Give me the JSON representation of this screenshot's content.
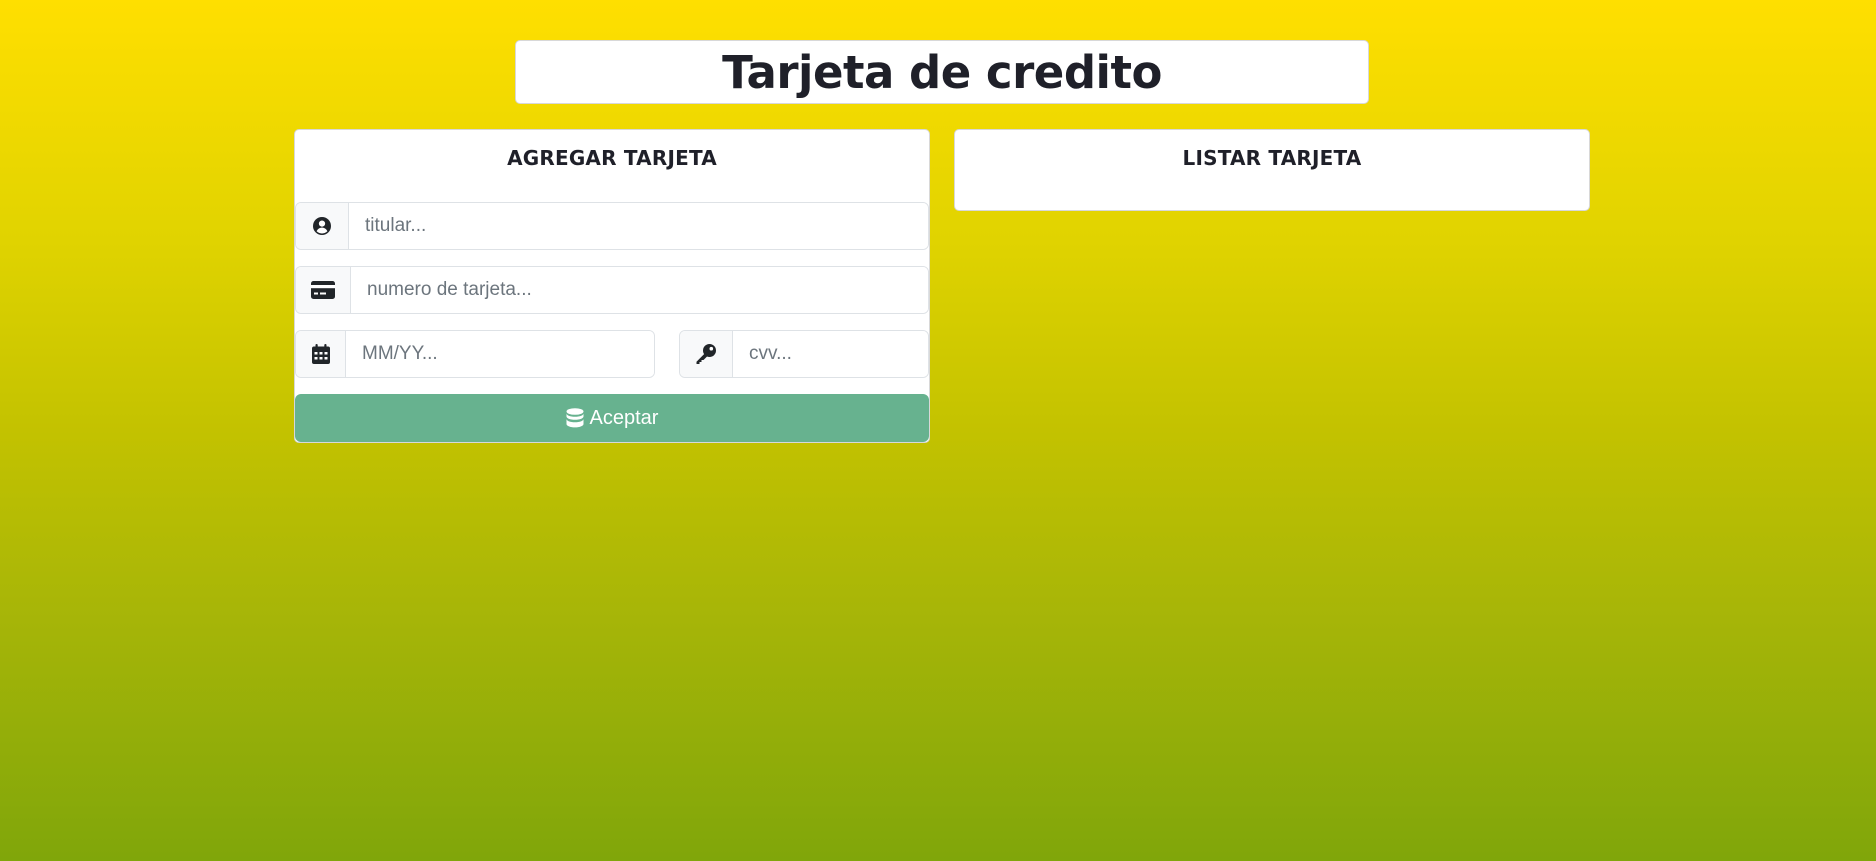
{
  "header": {
    "title": "Tarjeta de credito"
  },
  "add_card": {
    "title": "AGREGAR TARJETA",
    "fields": {
      "titular": {
        "placeholder": "titular...",
        "icon": "user-circle-icon"
      },
      "numero": {
        "placeholder": "numero de tarjeta...",
        "icon": "credit-card-icon"
      },
      "fecha": {
        "placeholder": "MM/YY...",
        "icon": "calendar-icon"
      },
      "cvv": {
        "placeholder": "cvv...",
        "icon": "key-icon"
      }
    },
    "submit": {
      "label": "Aceptar",
      "icon": "database-icon",
      "color": "#67b28f"
    }
  },
  "list_card": {
    "title": "LISTAR TARJETA"
  },
  "colors": {
    "background_top": "#ffdf00",
    "background_bottom": "#80a60a",
    "text": "#1f2029"
  }
}
